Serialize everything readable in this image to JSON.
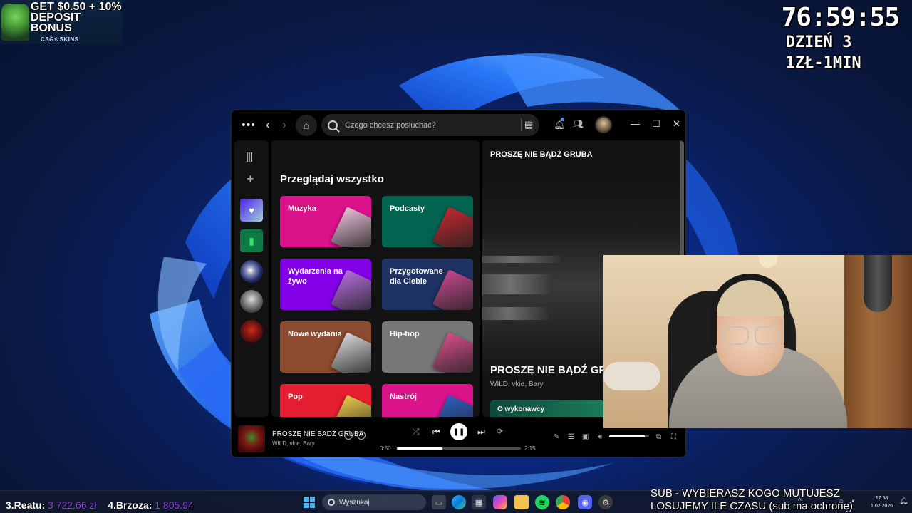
{
  "promo": {
    "line1": "GET $0.50 + 10%",
    "line2": "DEPOSIT BONUS",
    "brand": "CSG⚙SKINS"
  },
  "stream": {
    "timer": "76:59:55",
    "day": "DZIEŃ 3",
    "rate": "1ZŁ-1MIN",
    "leaderboard": [
      {
        "rank_name": "3.Reatu:",
        "amount": "3 722.66 zł"
      },
      {
        "rank_name": "4.Brzoza:",
        "amount": "1 805.94"
      }
    ],
    "sub_line1": "SUB - WYBIERASZ KOGO MUTUJESZ",
    "sub_line2": "LOSUJEMY ILE CZASU (sub ma ochronę)"
  },
  "spotify": {
    "search_placeholder": "Czego chcesz posłuchać?",
    "browse_title": "Przeglądaj wszystko",
    "categories": [
      {
        "label": "Muzyka",
        "color": "#dc148c",
        "art": "#e8c0d8"
      },
      {
        "label": "Podcasty",
        "color": "#006450",
        "art": "#c1272d"
      },
      {
        "label": "Wydarzenia na żywo",
        "color": "#8400e7",
        "art": "#b56ee0"
      },
      {
        "label": "Przygotowane dla Ciebie",
        "color": "#1e3264",
        "art": "#c6488e"
      },
      {
        "label": "Nowe wydania",
        "color": "#8d4b2f",
        "art": "#d7d7d7"
      },
      {
        "label": "Hip-hop",
        "color": "#777777",
        "art": "#d94c8a"
      },
      {
        "label": "Pop",
        "color": "#e61e32",
        "art": "#e8c94a"
      },
      {
        "label": "Nastrój",
        "color": "#dc148c",
        "art": "#2d5fbf"
      }
    ],
    "now_playing": {
      "header_title": "PROSZĘ NIE BĄDŹ GRUBA",
      "song_title": "PROSZĘ NIE BĄDŹ GRUBA",
      "artists": "WILD, vkie, Bary",
      "about_label": "O wykonawcy"
    },
    "player": {
      "title": "PROSZĘ NIE BĄDŹ GRUBA",
      "artist": "WILD, vkie, Bary",
      "elapsed": "0:50",
      "total": "2:15",
      "progress": 0.37,
      "volume": 0.9
    }
  },
  "taskbar": {
    "search_label": "Wyszukaj",
    "time": "17:58",
    "date": "1.02.2026"
  }
}
